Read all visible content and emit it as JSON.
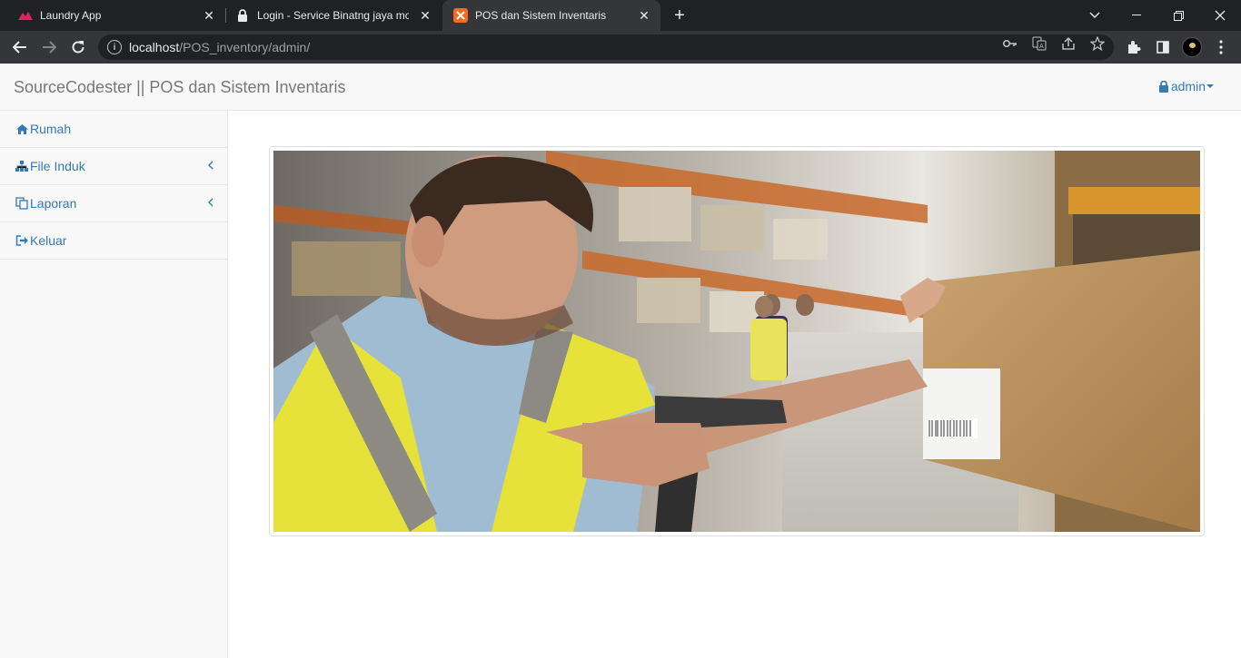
{
  "browser": {
    "tabs": [
      {
        "title": "Laundry App",
        "active": false
      },
      {
        "title": "Login - Service Binatng jaya motor",
        "active": false
      },
      {
        "title": "POS dan Sistem Inventaris",
        "active": true
      }
    ],
    "url_host": "localhost",
    "url_path": "/POS_inventory/admin/"
  },
  "header": {
    "brand": "SourceCodester || POS dan Sistem Inventaris",
    "user": "admin"
  },
  "sidebar": {
    "items": [
      {
        "label": "Rumah",
        "icon": "home-icon",
        "has_submenu": false
      },
      {
        "label": "File Induk",
        "icon": "sitemap-icon",
        "has_submenu": true
      },
      {
        "label": "Laporan",
        "icon": "copy-icon",
        "has_submenu": true
      },
      {
        "label": "Keluar",
        "icon": "sign-out-icon",
        "has_submenu": false
      }
    ]
  },
  "main": {
    "image": "warehouse-worker-scanning-box"
  },
  "colors": {
    "link": "#337ab7",
    "brand_text": "#777777",
    "chrome_dark": "#202124",
    "chrome_toolbar": "#35363a"
  }
}
